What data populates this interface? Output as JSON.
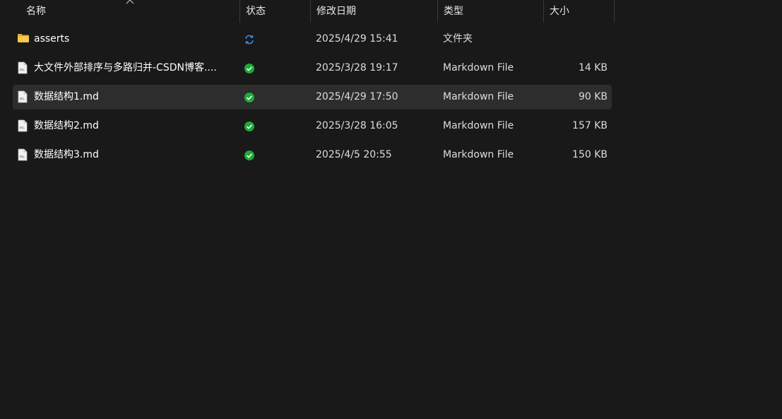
{
  "columns": {
    "name": "名称",
    "status": "状态",
    "modified": "修改日期",
    "type": "类型",
    "size": "大小"
  },
  "files": [
    {
      "name": "asserts",
      "icon": "folder-icon",
      "status": "sync-pending",
      "modified": "2025/4/29 15:41",
      "type": "文件夹",
      "size": "",
      "selected": false
    },
    {
      "name": "大文件外部排序与多路归并-CSDN博客....",
      "icon": "markdown-file-icon",
      "status": "synced",
      "modified": "2025/3/28 19:17",
      "type": "Markdown File",
      "size": "14 KB",
      "selected": false
    },
    {
      "name": "数据结构1.md",
      "icon": "markdown-file-icon",
      "status": "synced",
      "modified": "2025/4/29 17:50",
      "type": "Markdown File",
      "size": "90 KB",
      "selected": true
    },
    {
      "name": "数据结构2.md",
      "icon": "markdown-file-icon",
      "status": "synced",
      "modified": "2025/3/28 16:05",
      "type": "Markdown File",
      "size": "157 KB",
      "selected": false
    },
    {
      "name": "数据结构3.md",
      "icon": "markdown-file-icon",
      "status": "synced",
      "modified": "2025/4/5 20:55",
      "type": "Markdown File",
      "size": "150 KB",
      "selected": false
    }
  ],
  "colors": {
    "background": "#191919",
    "selected_row": "#2d2d2d",
    "synced_green": "#1faa3a",
    "sync_blue": "#3a8ee6",
    "folder_yellow": "#f4c542"
  }
}
